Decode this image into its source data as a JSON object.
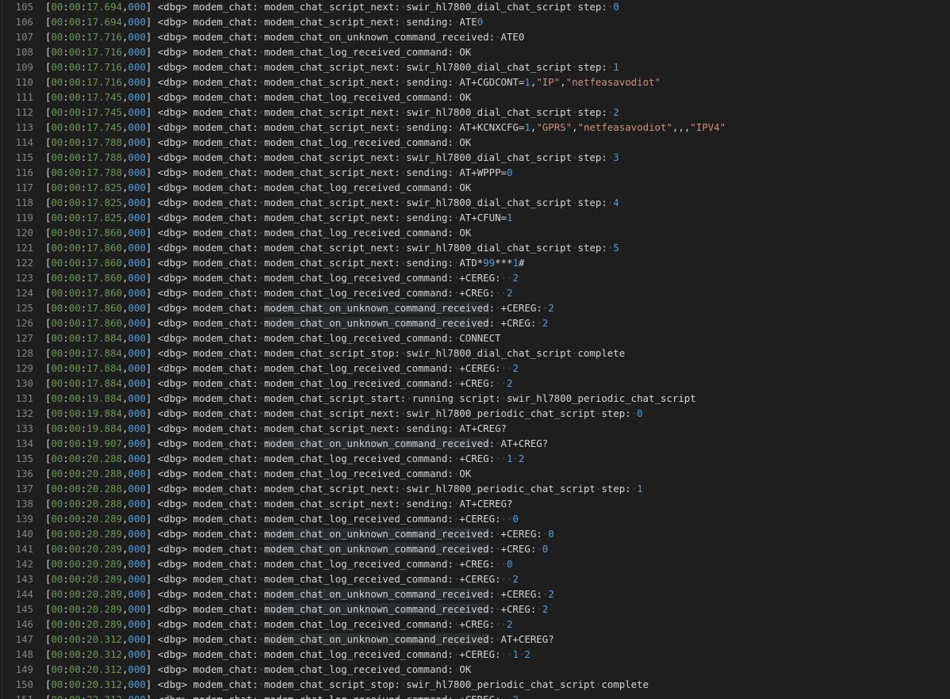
{
  "editor": {
    "lines": [
      {
        "no": "105",
        "ts": "00:00:17.694",
        "ms": "000",
        "fn": "modem_chat_script_next",
        "msg": "swir_hl7800_dial_chat_script",
        "tail": "step:",
        "val": "0",
        "hl": false
      },
      {
        "no": "106",
        "ts": "00:00:17.694",
        "ms": "000",
        "fn": "modem_chat_script_next",
        "msg": "sending:",
        "tail": "ATE0",
        "val": "",
        "hl": false
      },
      {
        "no": "107",
        "ts": "00:00:17.716",
        "ms": "000",
        "fn": "modem_chat_on_unknown_command_received",
        "msg": "ATE0",
        "tail": "",
        "val": "",
        "hl": false
      },
      {
        "no": "108",
        "ts": "00:00:17.716",
        "ms": "000",
        "fn": "modem_chat_log_received_command",
        "msg": "OK",
        "tail": "",
        "val": "",
        "hl": false
      },
      {
        "no": "109",
        "ts": "00:00:17.716",
        "ms": "000",
        "fn": "modem_chat_script_next",
        "msg": "swir_hl7800_dial_chat_script",
        "tail": "step:",
        "val": "1",
        "hl": false
      },
      {
        "no": "110",
        "ts": "00:00:17.716",
        "ms": "000",
        "fn": "modem_chat_script_next",
        "msg": "sending:",
        "tail": "AT+CGDCONT=1,\"IP\",\"netfeasavodiot\"",
        "val": "",
        "hl": false
      },
      {
        "no": "111",
        "ts": "00:00:17.745",
        "ms": "000",
        "fn": "modem_chat_log_received_command",
        "msg": "OK",
        "tail": "",
        "val": "",
        "hl": false
      },
      {
        "no": "112",
        "ts": "00:00:17.745",
        "ms": "000",
        "fn": "modem_chat_script_next",
        "msg": "swir_hl7800_dial_chat_script",
        "tail": "step:",
        "val": "2",
        "hl": false
      },
      {
        "no": "113",
        "ts": "00:00:17.745",
        "ms": "000",
        "fn": "modem_chat_script_next",
        "msg": "sending:",
        "tail": "AT+KCNXCFG=1,\"GPRS\",\"netfeasavodiot\",,,\"IPV4\"",
        "val": "",
        "hl": false
      },
      {
        "no": "114",
        "ts": "00:00:17.788",
        "ms": "000",
        "fn": "modem_chat_log_received_command",
        "msg": "OK",
        "tail": "",
        "val": "",
        "hl": false
      },
      {
        "no": "115",
        "ts": "00:00:17.788",
        "ms": "000",
        "fn": "modem_chat_script_next",
        "msg": "swir_hl7800_dial_chat_script",
        "tail": "step:",
        "val": "3",
        "hl": false
      },
      {
        "no": "116",
        "ts": "00:00:17.788",
        "ms": "000",
        "fn": "modem_chat_script_next",
        "msg": "sending:",
        "tail": "AT+WPPP=0",
        "val": "",
        "hl": false
      },
      {
        "no": "117",
        "ts": "00:00:17.825",
        "ms": "000",
        "fn": "modem_chat_log_received_command",
        "msg": "OK",
        "tail": "",
        "val": "",
        "hl": false
      },
      {
        "no": "118",
        "ts": "00:00:17.825",
        "ms": "000",
        "fn": "modem_chat_script_next",
        "msg": "swir_hl7800_dial_chat_script",
        "tail": "step:",
        "val": "4",
        "hl": false
      },
      {
        "no": "119",
        "ts": "00:00:17.825",
        "ms": "000",
        "fn": "modem_chat_script_next",
        "msg": "sending:",
        "tail": "AT+CFUN=1",
        "val": "",
        "hl": false
      },
      {
        "no": "120",
        "ts": "00:00:17.860",
        "ms": "000",
        "fn": "modem_chat_log_received_command",
        "msg": "OK",
        "tail": "",
        "val": "",
        "hl": false
      },
      {
        "no": "121",
        "ts": "00:00:17.860",
        "ms": "000",
        "fn": "modem_chat_script_next",
        "msg": "swir_hl7800_dial_chat_script",
        "tail": "step:",
        "val": "5",
        "hl": false
      },
      {
        "no": "122",
        "ts": "00:00:17.860",
        "ms": "000",
        "fn": "modem_chat_script_next",
        "msg": "sending:",
        "tail": "ATD*99***1#",
        "val": "",
        "hl": false
      },
      {
        "no": "123",
        "ts": "00:00:17.860",
        "ms": "000",
        "fn": "modem_chat_log_received_command",
        "msg": "+CEREG:",
        "tail": " 2",
        "val": "",
        "hl": false
      },
      {
        "no": "124",
        "ts": "00:00:17.860",
        "ms": "000",
        "fn": "modem_chat_log_received_command",
        "msg": "+CREG:",
        "tail": " 2",
        "val": "",
        "hl": false
      },
      {
        "no": "125",
        "ts": "00:00:17.860",
        "ms": "000",
        "fn": "modem_chat_on_unknown_command_received",
        "msg": "+CEREG:",
        "tail": "2",
        "val": "",
        "hl": true
      },
      {
        "no": "126",
        "ts": "00:00:17.860",
        "ms": "000",
        "fn": "modem_chat_on_unknown_command_received",
        "msg": "+CREG:",
        "tail": "2",
        "val": "",
        "hl": true
      },
      {
        "no": "127",
        "ts": "00:00:17.884",
        "ms": "000",
        "fn": "modem_chat_log_received_command",
        "msg": "CONNECT",
        "tail": "",
        "val": "",
        "hl": false
      },
      {
        "no": "128",
        "ts": "00:00:17.884",
        "ms": "000",
        "fn": "modem_chat_script_stop",
        "msg": "swir_hl7800_dial_chat_script",
        "tail": "complete",
        "val": "",
        "hl": false
      },
      {
        "no": "129",
        "ts": "00:00:17.884",
        "ms": "000",
        "fn": "modem_chat_log_received_command",
        "msg": "+CEREG:",
        "tail": " 2",
        "val": "",
        "hl": false
      },
      {
        "no": "130",
        "ts": "00:00:17.884",
        "ms": "000",
        "fn": "modem_chat_log_received_command",
        "msg": "+CREG:",
        "tail": " 2",
        "val": "",
        "hl": false
      },
      {
        "no": "131",
        "ts": "00:00:19.884",
        "ms": "000",
        "fn": "modem_chat_script_start",
        "msg": "running script:",
        "tail": "swir_hl7800_periodic_chat_script",
        "val": "",
        "hl": false
      },
      {
        "no": "132",
        "ts": "00:00:19.884",
        "ms": "000",
        "fn": "modem_chat_script_next",
        "msg": "swir_hl7800_periodic_chat_script",
        "tail": "step:",
        "val": "0",
        "hl": false
      },
      {
        "no": "133",
        "ts": "00:00:19.884",
        "ms": "000",
        "fn": "modem_chat_script_next",
        "msg": "sending:",
        "tail": "AT+CREG?",
        "val": "",
        "hl": false
      },
      {
        "no": "134",
        "ts": "00:00:19.907",
        "ms": "000",
        "fn": "modem_chat_on_unknown_command_received",
        "msg": "AT+CREG?",
        "tail": "",
        "val": "",
        "hl": true
      },
      {
        "no": "135",
        "ts": "00:00:20.288",
        "ms": "000",
        "fn": "modem_chat_log_received_command",
        "msg": "+CREG:",
        "tail": " 1 2",
        "val": "",
        "hl": false
      },
      {
        "no": "136",
        "ts": "00:00:20.288",
        "ms": "000",
        "fn": "modem_chat_log_received_command",
        "msg": "OK",
        "tail": "",
        "val": "",
        "hl": false
      },
      {
        "no": "137",
        "ts": "00:00:20.288",
        "ms": "000",
        "fn": "modem_chat_script_next",
        "msg": "swir_hl7800_periodic_chat_script",
        "tail": "step:",
        "val": "1",
        "hl": false
      },
      {
        "no": "138",
        "ts": "00:00:20.288",
        "ms": "000",
        "fn": "modem_chat_script_next",
        "msg": "sending:",
        "tail": "AT+CEREG?",
        "val": "",
        "hl": false
      },
      {
        "no": "139",
        "ts": "00:00:20.289",
        "ms": "000",
        "fn": "modem_chat_log_received_command",
        "msg": "+CEREG:",
        "tail": " 0",
        "val": "",
        "hl": false
      },
      {
        "no": "140",
        "ts": "00:00:20.289",
        "ms": "000",
        "fn": "modem_chat_on_unknown_command_received",
        "msg": "+CEREG:",
        "tail": "0",
        "val": "",
        "hl": true
      },
      {
        "no": "141",
        "ts": "00:00:20.289",
        "ms": "000",
        "fn": "modem_chat_on_unknown_command_received",
        "msg": "+CREG:",
        "tail": "0",
        "val": "",
        "hl": true
      },
      {
        "no": "142",
        "ts": "00:00:20.289",
        "ms": "000",
        "fn": "modem_chat_log_received_command",
        "msg": "+CREG:",
        "tail": " 0",
        "val": "",
        "hl": false
      },
      {
        "no": "143",
        "ts": "00:00:20.289",
        "ms": "000",
        "fn": "modem_chat_log_received_command",
        "msg": "+CEREG:",
        "tail": " 2",
        "val": "",
        "hl": false
      },
      {
        "no": "144",
        "ts": "00:00:20.289",
        "ms": "000",
        "fn": "modem_chat_on_unknown_command_received",
        "msg": "+CEREG:",
        "tail": "2",
        "val": "",
        "hl": true
      },
      {
        "no": "145",
        "ts": "00:00:20.289",
        "ms": "000",
        "fn": "modem_chat_on_unknown_command_received",
        "msg": "+CREG:",
        "tail": "2",
        "val": "",
        "hl": true
      },
      {
        "no": "146",
        "ts": "00:00:20.289",
        "ms": "000",
        "fn": "modem_chat_log_received_command",
        "msg": "+CREG:",
        "tail": " 2",
        "val": "",
        "hl": false
      },
      {
        "no": "147",
        "ts": "00:00:20.312",
        "ms": "000",
        "fn": "modem_chat_on_unknown_command_received",
        "msg": "AT+CEREG?",
        "tail": "",
        "val": "",
        "hl": true
      },
      {
        "no": "148",
        "ts": "00:00:20.312",
        "ms": "000",
        "fn": "modem_chat_log_received_command",
        "msg": "+CEREG:",
        "tail": " 1 2",
        "val": "",
        "hl": false
      },
      {
        "no": "149",
        "ts": "00:00:20.312",
        "ms": "000",
        "fn": "modem_chat_log_received_command",
        "msg": "OK",
        "tail": "",
        "val": "",
        "hl": false
      },
      {
        "no": "150",
        "ts": "00:00:20.312",
        "ms": "000",
        "fn": "modem_chat_script_stop",
        "msg": "swir_hl7800_periodic_chat_script",
        "tail": "complete",
        "val": "",
        "hl": false
      },
      {
        "no": "151",
        "ts": "00:00:22.312",
        "ms": "000",
        "fn": "modem_chat_log_received_command",
        "msg": "+CEREG:",
        "tail": " 2",
        "val": "",
        "hl": false
      }
    ],
    "level_tag": "<dbg>",
    "module": "modem_chat"
  }
}
